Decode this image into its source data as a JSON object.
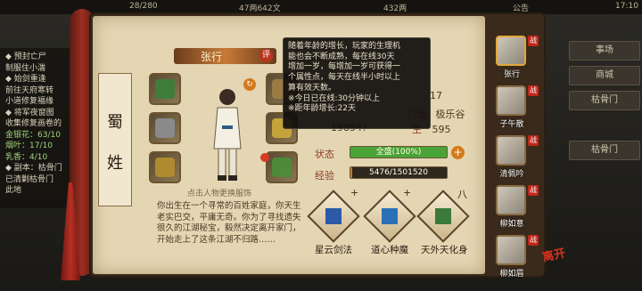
{
  "topbar": {
    "stat_left": "28/280",
    "copper": "47两642文",
    "gold": "432两",
    "notice": "公告",
    "clock": "17:10"
  },
  "quests": [
    {
      "text": "◆ 预封亡尸",
      "kind": "title"
    },
    {
      "text": "制服住小湍",
      "kind": "line"
    },
    {
      "text": "◆ 始剑重逢",
      "kind": "title"
    },
    {
      "text": "前往天府寒转",
      "kind": "line"
    },
    {
      "text": "小道修复福缘",
      "kind": "line"
    },
    {
      "text": "◆ 将军夜窗图",
      "kind": "title"
    },
    {
      "text": "收集修复画卷的",
      "kind": "line"
    },
    {
      "text": "金银花：63/10",
      "kind": "hl"
    },
    {
      "text": "烟叶：17/10",
      "kind": "hl"
    },
    {
      "text": "乳香：4/10",
      "kind": "hl"
    },
    {
      "text": "◆ 副本：枯骨门",
      "kind": "title"
    },
    {
      "text": "已清剿枯骨门",
      "kind": "line"
    },
    {
      "text": "此地",
      "kind": "line"
    }
  ],
  "side_menu": [
    "事场",
    "商城",
    "枯骨门",
    "枯骨门"
  ],
  "character": {
    "name": "张行",
    "rate_badge": "评",
    "family_col1": "蜀",
    "family_col2": "姓",
    "hint": "点击人物更换服饰",
    "age_value": "17",
    "sect_label": "门派",
    "sect": "极乐谷",
    "money_label": "生",
    "money_value": "595",
    "power_value": "19854?",
    "state_label": "状态",
    "state_value": "全盛(100%)",
    "state_fraction": 1.0,
    "exp_label": "经验",
    "exp_value": "5476/1501520",
    "exp_fraction": 0.0036,
    "bio": "你出生在一个寻常的百姓家庭，你天生老实巴交，平庸无奇。你为了寻找遗失很久的江湖秘宝，毅然决定离开家门，开始走上了这条江湖不归路……"
  },
  "skills": [
    {
      "name": "星云剑法",
      "mark": "+",
      "icon": "book-icon",
      "color": "#2d5aa8"
    },
    {
      "name": "道心种魔",
      "mark": "+",
      "icon": "scroll-icon",
      "color": "#2b6fb5"
    },
    {
      "name": "天外天化身",
      "mark": "八",
      "icon": "figure-icon",
      "color": "#3b7a3a"
    }
  ],
  "roster": [
    {
      "name": "张行",
      "badge": "战",
      "active": true
    },
    {
      "name": "子午散",
      "badge": "战",
      "active": false
    },
    {
      "name": "清佩吟",
      "badge": "战",
      "active": false
    },
    {
      "name": "柳如意",
      "badge": "战",
      "active": false
    },
    {
      "name": "柳如眉",
      "badge": "战",
      "active": false
    }
  ],
  "roster_seal": "离开",
  "tooltip": {
    "title": "?",
    "lines": [
      "随着年龄的增长，玩家的生理机",
      "能也会不断成熟，每在线30天",
      "增加一岁，每增加一岁可获得一",
      "个属性点，每天在线半小时以上",
      "算有效天数。",
      "※今日已在线:30分钟以上",
      "※距年龄增长:22天"
    ]
  },
  "colors": {
    "state_fill": "#4aa336",
    "exp_fill": "#c07a2a",
    "accent_red": "#c0271b"
  }
}
